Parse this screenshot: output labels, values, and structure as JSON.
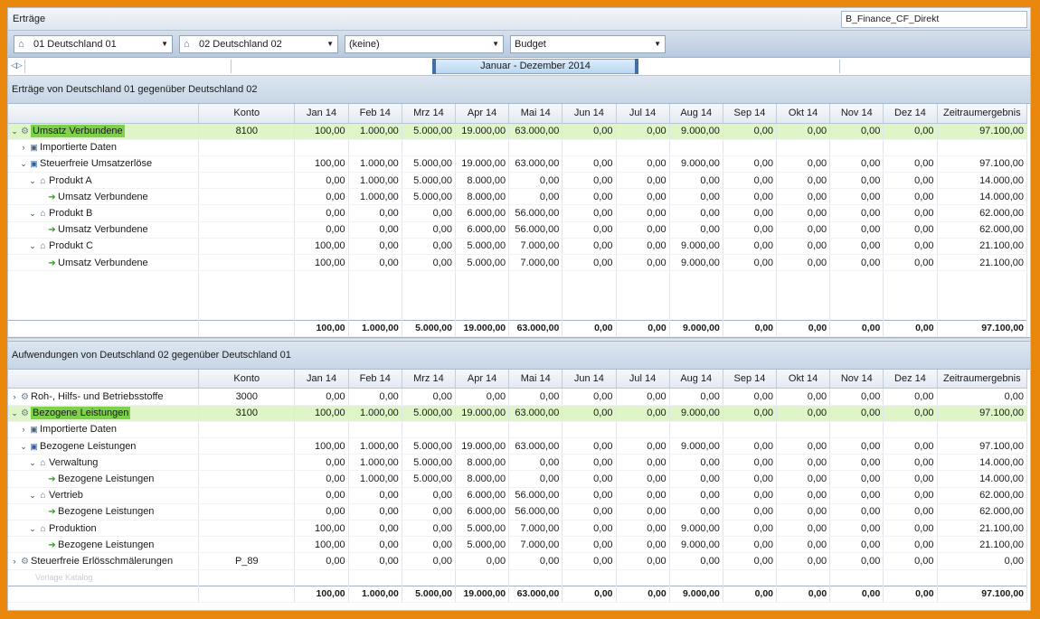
{
  "window": {
    "title": "Erträge",
    "ident": "B_Finance_CF_Direkt"
  },
  "filters": [
    {
      "icon": "home-icon",
      "label": "01 Deutschland 01"
    },
    {
      "icon": "home-icon",
      "label": "02 Deutschland 02"
    },
    {
      "icon": "",
      "label": "(keine)"
    },
    {
      "icon": "",
      "label": "Budget"
    }
  ],
  "timebar": {
    "period": "Januar - Dezember 2014"
  },
  "columns": [
    "Konto",
    "Jan 14",
    "Feb 14",
    "Mrz 14",
    "Apr 14",
    "Mai 14",
    "Jun 14",
    "Jul 14",
    "Aug 14",
    "Sep 14",
    "Okt 14",
    "Nov 14",
    "Dez 14",
    "Zeitraumergebnis"
  ],
  "section1": {
    "title": "Erträge von Deutschland 01 gegenüber Deutschland 02",
    "rows": [
      {
        "name": "Umsatz Verbundene",
        "level": 0,
        "expand": "⌄",
        "icon": "gear",
        "hl": true,
        "konto": "8100",
        "values": [
          "100,00",
          "1.000,00",
          "5.000,00",
          "19.000,00",
          "63.000,00",
          "0,00",
          "0,00",
          "9.000,00",
          "0,00",
          "0,00",
          "0,00",
          "0,00",
          "97.100,00"
        ]
      },
      {
        "name": "Importierte Daten",
        "level": 1,
        "expand": "›",
        "icon": "box",
        "konto": "",
        "values": [
          "",
          "",
          "",
          "",
          "",
          "",
          "",
          "",
          "",
          "",
          "",
          "",
          ""
        ]
      },
      {
        "name": "Steuerfreie Umsatzerlöse",
        "level": 1,
        "expand": "⌄",
        "icon": "blue",
        "konto": "",
        "values": [
          "100,00",
          "1.000,00",
          "5.000,00",
          "19.000,00",
          "63.000,00",
          "0,00",
          "0,00",
          "9.000,00",
          "0,00",
          "0,00",
          "0,00",
          "0,00",
          "97.100,00"
        ]
      },
      {
        "name": "Produkt A",
        "level": 2,
        "expand": "⌄",
        "icon": "house",
        "konto": "",
        "values": [
          "0,00",
          "1.000,00",
          "5.000,00",
          "8.000,00",
          "0,00",
          "0,00",
          "0,00",
          "0,00",
          "0,00",
          "0,00",
          "0,00",
          "0,00",
          "14.000,00"
        ]
      },
      {
        "name": "Umsatz Verbundene",
        "level": 3,
        "expand": "",
        "icon": "arrow",
        "konto": "",
        "values": [
          "0,00",
          "1.000,00",
          "5.000,00",
          "8.000,00",
          "0,00",
          "0,00",
          "0,00",
          "0,00",
          "0,00",
          "0,00",
          "0,00",
          "0,00",
          "14.000,00"
        ]
      },
      {
        "name": "Produkt B",
        "level": 2,
        "expand": "⌄",
        "icon": "house",
        "konto": "",
        "values": [
          "0,00",
          "0,00",
          "0,00",
          "6.000,00",
          "56.000,00",
          "0,00",
          "0,00",
          "0,00",
          "0,00",
          "0,00",
          "0,00",
          "0,00",
          "62.000,00"
        ]
      },
      {
        "name": "Umsatz Verbundene",
        "level": 3,
        "expand": "",
        "icon": "arrow",
        "konto": "",
        "values": [
          "0,00",
          "0,00",
          "0,00",
          "6.000,00",
          "56.000,00",
          "0,00",
          "0,00",
          "0,00",
          "0,00",
          "0,00",
          "0,00",
          "0,00",
          "62.000,00"
        ]
      },
      {
        "name": "Produkt C",
        "level": 2,
        "expand": "⌄",
        "icon": "house",
        "konto": "",
        "values": [
          "100,00",
          "0,00",
          "0,00",
          "5.000,00",
          "7.000,00",
          "0,00",
          "0,00",
          "9.000,00",
          "0,00",
          "0,00",
          "0,00",
          "0,00",
          "21.100,00"
        ]
      },
      {
        "name": "Umsatz Verbundene",
        "level": 3,
        "expand": "",
        "icon": "arrow",
        "konto": "",
        "values": [
          "100,00",
          "0,00",
          "0,00",
          "5.000,00",
          "7.000,00",
          "0,00",
          "0,00",
          "9.000,00",
          "0,00",
          "0,00",
          "0,00",
          "0,00",
          "21.100,00"
        ]
      }
    ],
    "totals": [
      "100,00",
      "1.000,00",
      "5.000,00",
      "19.000,00",
      "63.000,00",
      "0,00",
      "0,00",
      "9.000,00",
      "0,00",
      "0,00",
      "0,00",
      "0,00",
      "97.100,00"
    ]
  },
  "section2": {
    "title": "Aufwendungen von Deutschland 02 gegenüber Deutschland 01",
    "rows": [
      {
        "name": "Roh-, Hilfs- und Betriebsstoffe",
        "level": 0,
        "expand": "›",
        "icon": "gear",
        "konto": "3000",
        "values": [
          "0,00",
          "0,00",
          "0,00",
          "0,00",
          "0,00",
          "0,00",
          "0,00",
          "0,00",
          "0,00",
          "0,00",
          "0,00",
          "0,00",
          "0,00"
        ]
      },
      {
        "name": "Bezogene Leistungen",
        "level": 0,
        "expand": "⌄",
        "icon": "gear",
        "hl": true,
        "konto": "3100",
        "values": [
          "100,00",
          "1.000,00",
          "5.000,00",
          "19.000,00",
          "63.000,00",
          "0,00",
          "0,00",
          "9.000,00",
          "0,00",
          "0,00",
          "0,00",
          "0,00",
          "97.100,00"
        ]
      },
      {
        "name": "Importierte Daten",
        "level": 1,
        "expand": "›",
        "icon": "box",
        "konto": "",
        "values": [
          "",
          "",
          "",
          "",
          "",
          "",
          "",
          "",
          "",
          "",
          "",
          "",
          ""
        ]
      },
      {
        "name": "Bezogene Leistungen",
        "level": 1,
        "expand": "⌄",
        "icon": "blue",
        "konto": "",
        "values": [
          "100,00",
          "1.000,00",
          "5.000,00",
          "19.000,00",
          "63.000,00",
          "0,00",
          "0,00",
          "9.000,00",
          "0,00",
          "0,00",
          "0,00",
          "0,00",
          "97.100,00"
        ]
      },
      {
        "name": "Verwaltung",
        "level": 2,
        "expand": "⌄",
        "icon": "house",
        "konto": "",
        "values": [
          "0,00",
          "1.000,00",
          "5.000,00",
          "8.000,00",
          "0,00",
          "0,00",
          "0,00",
          "0,00",
          "0,00",
          "0,00",
          "0,00",
          "0,00",
          "14.000,00"
        ]
      },
      {
        "name": "Bezogene Leistungen",
        "level": 3,
        "expand": "",
        "icon": "arrow",
        "konto": "",
        "values": [
          "0,00",
          "1.000,00",
          "5.000,00",
          "8.000,00",
          "0,00",
          "0,00",
          "0,00",
          "0,00",
          "0,00",
          "0,00",
          "0,00",
          "0,00",
          "14.000,00"
        ]
      },
      {
        "name": "Vertrieb",
        "level": 2,
        "expand": "⌄",
        "icon": "house",
        "konto": "",
        "values": [
          "0,00",
          "0,00",
          "0,00",
          "6.000,00",
          "56.000,00",
          "0,00",
          "0,00",
          "0,00",
          "0,00",
          "0,00",
          "0,00",
          "0,00",
          "62.000,00"
        ]
      },
      {
        "name": "Bezogene Leistungen",
        "level": 3,
        "expand": "",
        "icon": "arrow",
        "konto": "",
        "values": [
          "0,00",
          "0,00",
          "0,00",
          "6.000,00",
          "56.000,00",
          "0,00",
          "0,00",
          "0,00",
          "0,00",
          "0,00",
          "0,00",
          "0,00",
          "62.000,00"
        ]
      },
      {
        "name": "Produktion",
        "level": 2,
        "expand": "⌄",
        "icon": "house",
        "konto": "",
        "values": [
          "100,00",
          "0,00",
          "0,00",
          "5.000,00",
          "7.000,00",
          "0,00",
          "0,00",
          "9.000,00",
          "0,00",
          "0,00",
          "0,00",
          "0,00",
          "21.100,00"
        ]
      },
      {
        "name": "Bezogene Leistungen",
        "level": 3,
        "expand": "",
        "icon": "arrow",
        "konto": "",
        "values": [
          "100,00",
          "0,00",
          "0,00",
          "5.000,00",
          "7.000,00",
          "0,00",
          "0,00",
          "9.000,00",
          "0,00",
          "0,00",
          "0,00",
          "0,00",
          "21.100,00"
        ]
      },
      {
        "name": "Steuerfreie Erlösschmälerungen",
        "level": 0,
        "expand": "›",
        "icon": "gear",
        "konto": "P_89",
        "values": [
          "0,00",
          "0,00",
          "0,00",
          "0,00",
          "0,00",
          "0,00",
          "0,00",
          "0,00",
          "0,00",
          "0,00",
          "0,00",
          "0,00",
          "0,00"
        ]
      }
    ],
    "ghost": "Vorlage Katalog",
    "totals": [
      "100,00",
      "1.000,00",
      "5.000,00",
      "19.000,00",
      "63.000,00",
      "0,00",
      "0,00",
      "9.000,00",
      "0,00",
      "0,00",
      "0,00",
      "0,00",
      "97.100,00"
    ]
  }
}
